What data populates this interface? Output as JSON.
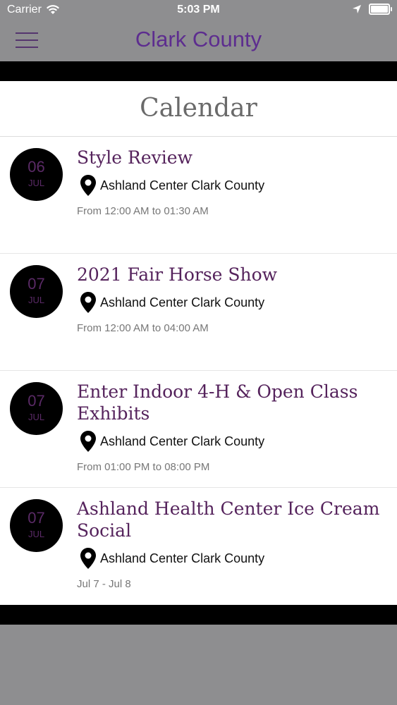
{
  "status_bar": {
    "carrier": "Carrier",
    "time": "5:03 PM"
  },
  "nav": {
    "title": "Clark County"
  },
  "page": {
    "heading": "Calendar"
  },
  "events": [
    {
      "day": "06",
      "month": "JUL",
      "title": "Style Review",
      "location": "Ashland Center Clark County",
      "time": "From 12:00 AM to 01:30 AM"
    },
    {
      "day": "07",
      "month": "JUL",
      "title": "2021 Fair Horse Show",
      "location": "Ashland Center Clark County",
      "time": "From 12:00 AM to 04:00 AM"
    },
    {
      "day": "07",
      "month": "JUL",
      "title": "Enter Indoor 4-H & Open Class Exhibits",
      "location": "Ashland Center Clark County",
      "time": "From 01:00 PM to 08:00 PM"
    },
    {
      "day": "07",
      "month": "JUL",
      "title": "Ashland Health Center Ice Cream Social",
      "location": "Ashland Center Clark County",
      "time": "Jul 7 - Jul 8"
    }
  ],
  "colors": {
    "accent": "#5d2d8f",
    "event_title": "#55235c",
    "chrome": "#8e8e90"
  }
}
